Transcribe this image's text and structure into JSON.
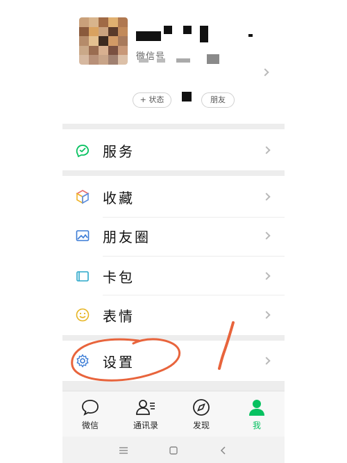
{
  "profile": {
    "wechat_id_label": "微信号",
    "status_button_label": "+ 状态",
    "friends_pill_label": "朋友"
  },
  "menu": {
    "services": "服务",
    "favorites": "收藏",
    "moments": "朋友圈",
    "cards": "卡包",
    "stickers": "表情",
    "settings": "设置"
  },
  "tabs": {
    "chats": "微信",
    "contacts": "通讯录",
    "discover": "发现",
    "me": "我"
  },
  "colors": {
    "accent": "#07c160",
    "annotation": "#e8643c"
  }
}
